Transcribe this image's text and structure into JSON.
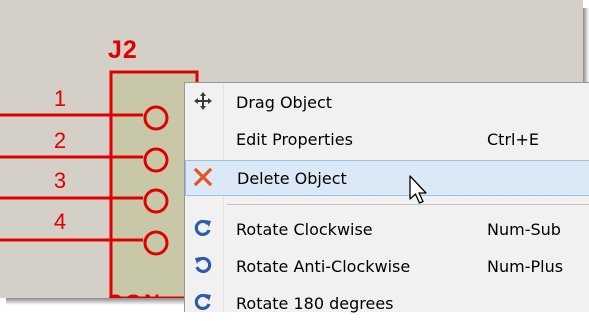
{
  "part": {
    "reference": "J2",
    "pins": [
      "1",
      "2",
      "3",
      "4"
    ],
    "bottom_text": "CON"
  },
  "context_menu": {
    "items": [
      {
        "label": "Drag Object",
        "shortcut": "",
        "icon": "move-arrows-icon"
      },
      {
        "label": "Edit Properties",
        "shortcut": "Ctrl+E",
        "icon": ""
      },
      {
        "label": "Delete Object",
        "shortcut": "",
        "icon": "delete-x-icon"
      },
      {
        "label": "Rotate Clockwise",
        "shortcut": "Num-Sub",
        "icon": "rotate-clockwise-icon"
      },
      {
        "label": "Rotate Anti-Clockwise",
        "shortcut": "Num-Plus",
        "icon": "rotate-anticlockwise-icon"
      },
      {
        "label": "Rotate 180 degrees",
        "shortcut": "",
        "icon": "rotate-180-icon"
      }
    ],
    "hovered_item": "Delete Object"
  },
  "colors": {
    "schematic_red": "#e00000",
    "component_fill": "#c8c8a8",
    "background": "#d4d0c8",
    "menu_background": "#f1f1f1",
    "hover_background": "#dbe9f7",
    "hover_border": "#99c2ea",
    "icon_blue": "#2a5ea8",
    "icon_orange": "#e8541e"
  }
}
